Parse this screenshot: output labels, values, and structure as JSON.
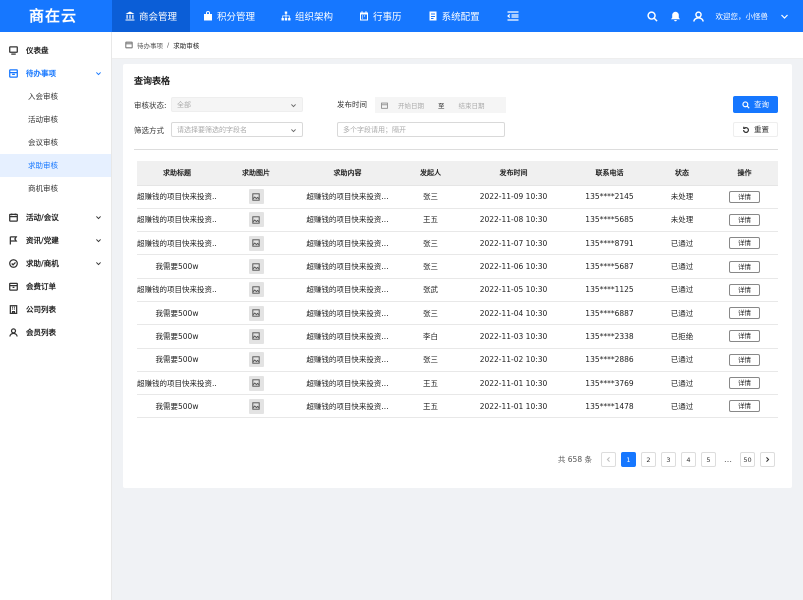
{
  "brand": "商在云",
  "nav": [
    {
      "label": "商会管理",
      "icon": "bank-icon",
      "active": true
    },
    {
      "label": "积分管理",
      "icon": "bag-icon",
      "active": false
    },
    {
      "label": "组织架构",
      "icon": "org-icon",
      "active": false
    },
    {
      "label": "行事历",
      "icon": "calendar-icon",
      "active": false
    },
    {
      "label": "系统配置",
      "icon": "config-icon",
      "active": false
    }
  ],
  "header": {
    "welcome": "欢迎您，小怪兽"
  },
  "sidebar": {
    "items": [
      {
        "label": "仪表盘",
        "icon": "monitor-icon"
      },
      {
        "label": "待办事项",
        "icon": "inbox-icon"
      },
      {
        "label": "活动/会议",
        "icon": "calendar-icon"
      },
      {
        "label": "资讯/党建",
        "icon": "flag-icon"
      },
      {
        "label": "求助/商机",
        "icon": "check-circle-icon"
      },
      {
        "label": "会费订单",
        "icon": "wallet-icon"
      },
      {
        "label": "公司列表",
        "icon": "building-icon"
      },
      {
        "label": "会员列表",
        "icon": "user-icon"
      }
    ],
    "subs": [
      "入会审核",
      "活动审核",
      "会议审核",
      "求助审核",
      "商机审核"
    ]
  },
  "breadcrumb": {
    "parent": "待办事项",
    "sep": "/",
    "current": "求助审核"
  },
  "form": {
    "title": "查询表格",
    "status_label": "审核状态:",
    "status_value": "全部",
    "time_label": "发布时间",
    "start_placeholder": "开始日期",
    "to": "至",
    "end_placeholder": "结束日期",
    "filter_label": "筛选方式",
    "filter_placeholder": "请选择要筛选的字段名",
    "multi_placeholder": "多个字段请用；隔开",
    "search_btn": "查询",
    "reset_btn": "重置"
  },
  "table": {
    "headers": [
      "求助标题",
      "求助图片",
      "求助内容",
      "发起人",
      "发布时间",
      "联系电话",
      "状态",
      "操作"
    ],
    "rows": [
      {
        "title": "超赚钱的项目快来投资...",
        "content": "超赚钱的项目快来投资...",
        "user": "张三",
        "time": "2022-11-09  10:30",
        "phone": "135****2145",
        "status": "未处理",
        "kind": "pending",
        "action": "详情"
      },
      {
        "title": "超赚钱的项目快来投资...",
        "content": "超赚钱的项目快来投资...",
        "user": "王五",
        "time": "2022-11-08  10:30",
        "phone": "135****5685",
        "status": "未处理",
        "kind": "pending",
        "action": "详情"
      },
      {
        "title": "超赚钱的项目快来投资...",
        "content": "超赚钱的项目快来投资...",
        "user": "张三",
        "time": "2022-11-07  10:30",
        "phone": "135****8791",
        "status": "已通过",
        "kind": "pass",
        "action": "详情"
      },
      {
        "title": "我需要500w",
        "content": "超赚钱的项目快来投资...",
        "user": "张三",
        "time": "2022-11-06  10:30",
        "phone": "135****5687",
        "status": "已通过",
        "kind": "pass",
        "action": "详情"
      },
      {
        "title": "超赚钱的项目快来投资...",
        "content": "超赚钱的项目快来投资...",
        "user": "张武",
        "time": "2022-11-05  10:30",
        "phone": "135****1125",
        "status": "已通过",
        "kind": "pass",
        "action": "详情"
      },
      {
        "title": "我需要500w",
        "content": "超赚钱的项目快来投资...",
        "user": "张三",
        "time": "2022-11-04  10:30",
        "phone": "135****6887",
        "status": "已通过",
        "kind": "pass",
        "action": "详情"
      },
      {
        "title": "我需要500w",
        "content": "超赚钱的项目快来投资...",
        "user": "李白",
        "time": "2022-11-03  10:30",
        "phone": "135****2338",
        "status": "已拒绝",
        "kind": "reject",
        "action": "详情"
      },
      {
        "title": "我需要500w",
        "content": "超赚钱的项目快来投资...",
        "user": "张三",
        "time": "2022-11-02  10:30",
        "phone": "135****2886",
        "status": "已通过",
        "kind": "pass",
        "action": "详情"
      },
      {
        "title": "超赚钱的项目快来投资...",
        "content": "超赚钱的项目快来投资...",
        "user": "王五",
        "time": "2022-11-01  10:30",
        "phone": "135****3769",
        "status": "已通过",
        "kind": "pass",
        "action": "详情"
      },
      {
        "title": "我需要500w",
        "content": "超赚钱的项目快来投资...",
        "user": "王五",
        "time": "2022-11-01  10:30",
        "phone": "135****1478",
        "status": "已通过",
        "kind": "pass",
        "action": "详情"
      }
    ]
  },
  "pagination": {
    "total": "共 658 条",
    "pages": [
      "1",
      "2",
      "3",
      "4",
      "5"
    ],
    "ellipsis": "…",
    "last": "50",
    "current": "1"
  }
}
